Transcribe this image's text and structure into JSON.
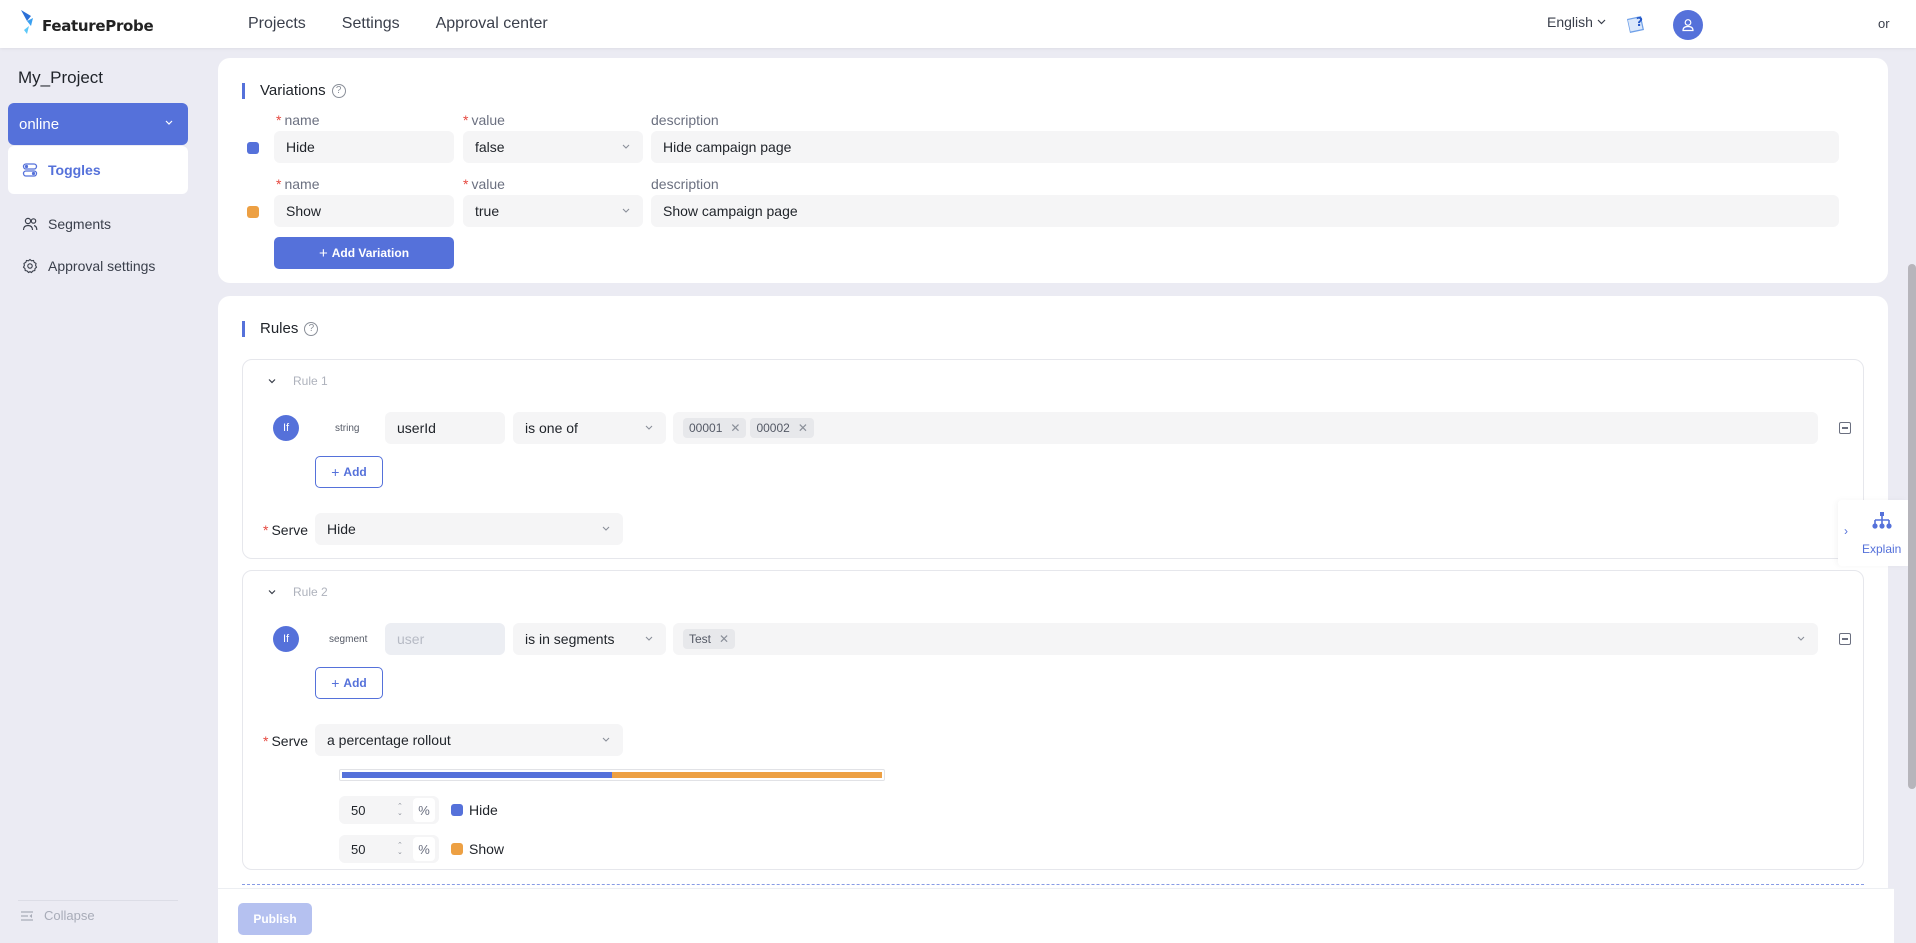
{
  "header": {
    "logo_text": "FeatureProbe",
    "nav": [
      "Projects",
      "Settings",
      "Approval center"
    ],
    "language": "English",
    "user_name": "or"
  },
  "sidebar": {
    "project_name": "My_Project",
    "environment": "online",
    "items": [
      {
        "label": "Toggles",
        "icon": "toggles-icon",
        "active": true
      },
      {
        "label": "Segments",
        "icon": "users-icon",
        "active": false
      },
      {
        "label": "Approval settings",
        "icon": "gear-icon",
        "active": false
      }
    ],
    "collapse_label": "Collapse"
  },
  "variations": {
    "title": "Variations",
    "name_label": "name",
    "value_label": "value",
    "description_label": "description",
    "items": [
      {
        "name": "Hide",
        "value": "false",
        "description": "Hide campaign  page",
        "color": "#5571da"
      },
      {
        "name": "Show",
        "value": "true",
        "description": "Show campaign  page",
        "color": "#eda043"
      }
    ],
    "add_button": "Add Variation"
  },
  "rules": {
    "title": "Rules",
    "if_label": "If",
    "add_label": "Add",
    "serve_label": "Serve",
    "items": [
      {
        "title": "Rule 1",
        "type": "string",
        "subject": "userId",
        "subject_placeholder": "",
        "operator": "is one of",
        "values": [
          "00001",
          "00002"
        ],
        "serve": "Hide"
      },
      {
        "title": "Rule 2",
        "type": "segment",
        "subject": "",
        "subject_placeholder": "user",
        "operator": "is in segments",
        "values": [
          "Test"
        ],
        "serve": "a percentage rollout",
        "rollout": [
          {
            "variation": "Hide",
            "percent": 50,
            "color": "#5571da"
          },
          {
            "variation": "Show",
            "percent": 50,
            "color": "#eda043"
          }
        ],
        "percent_unit": "%"
      }
    ]
  },
  "footer": {
    "publish_label": "Publish"
  },
  "explain": {
    "label": "Explain"
  },
  "colors": {
    "accent": "#5571da",
    "orange": "#eda043",
    "required": "#e5483f"
  }
}
